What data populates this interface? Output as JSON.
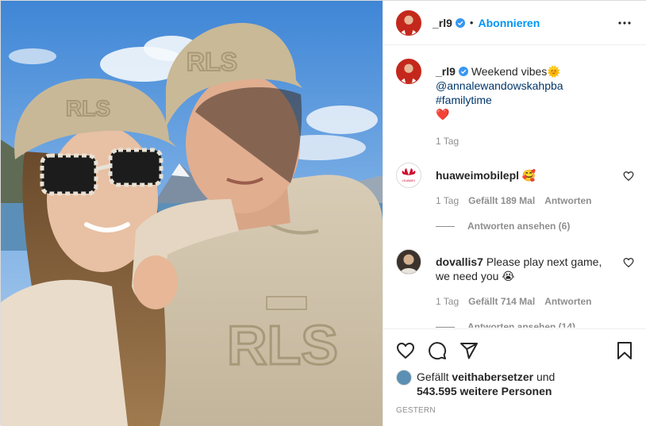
{
  "post": {
    "username": "_rl9",
    "follow_label": "Abonnieren",
    "separator": "•",
    "caption": {
      "username": "_rl9",
      "text": "Weekend vibes",
      "emoji_sun": "🌞",
      "mention": "@annalewandowskahpba",
      "hashtag": "#familytime",
      "emoji_heart": "❤️",
      "time": "1 Tag"
    },
    "comments": [
      {
        "username": "huaweimobilepl",
        "text": "",
        "emoji": "🥰",
        "time": "1 Tag",
        "likes": "Gefällt 189 Mal",
        "reply": "Antworten",
        "view_replies": "Antworten ansehen (6)"
      },
      {
        "username": "dovallis7",
        "text": "Please play next game, we need you",
        "emoji": "😭",
        "time": "1 Tag",
        "likes": "Gefällt 714 Mal",
        "reply": "Antworten",
        "view_replies": "Antworten ansehen (14)"
      }
    ],
    "likes": {
      "prefix": "Gefällt",
      "user": "veithabersetzer",
      "mid": "und",
      "count": "543.595 weitere Personen"
    },
    "date": "GESTERN",
    "photo_cap_logo": "RLS",
    "hoodie_logo": "RLS"
  },
  "colors": {
    "link": "#0095f6",
    "text": "#262626",
    "muted": "#8e8e8e",
    "mention": "#00376b",
    "brand_red": "#c4281c"
  },
  "icons": {
    "verified": "verified-badge-icon",
    "more": "more-options-icon",
    "like": "heart-icon",
    "comment": "comment-icon",
    "share": "share-icon",
    "save": "bookmark-icon"
  }
}
